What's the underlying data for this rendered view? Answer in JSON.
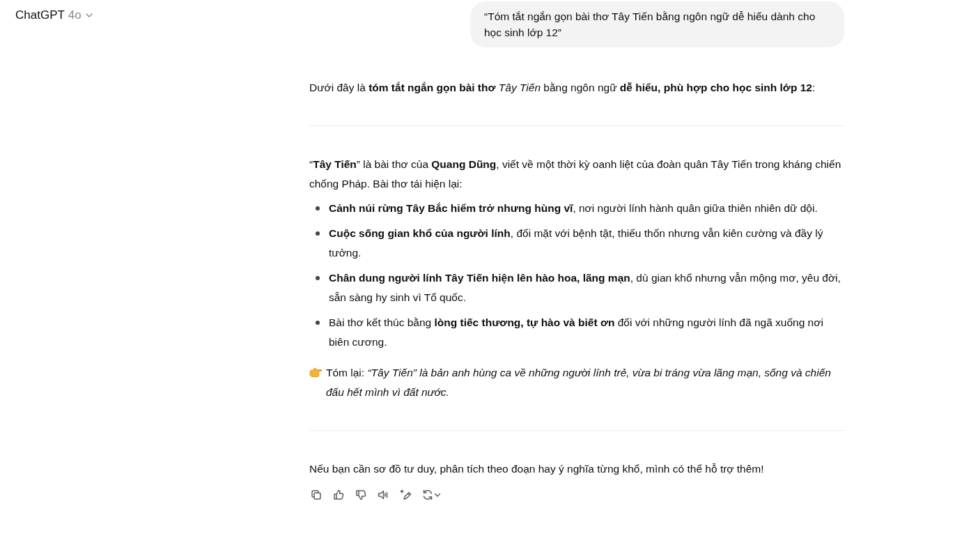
{
  "header": {
    "title": "ChatGPT",
    "model": "4o"
  },
  "user_message": "“Tóm tắt ngắn gọn bài thơ Tây Tiến bằng ngôn ngữ dễ hiểu dành cho học sinh lớp 12”",
  "assistant_message": {
    "blocks": [
      {
        "kind": "paragraph",
        "text": "Dưới đây là **tóm tắt ngắn gọn bài thơ** *Tây Tiến* bằng ngôn ngữ **dễ hiểu, phù hợp cho học sinh lớp 12**:"
      },
      {
        "kind": "divider"
      },
      {
        "kind": "paragraph",
        "text": "“**Tây Tiến**” là bài thơ của **Quang Dũng**, viết về một thời kỳ oanh liệt của đoàn quân Tây Tiến trong kháng chiến chống Pháp. Bài thơ tái hiện lại:"
      },
      {
        "kind": "list",
        "items": [
          "**Cảnh núi rừng Tây Bắc hiểm trở nhưng hùng vĩ**, nơi người lính hành quân giữa thiên nhiên dữ dội.",
          "**Cuộc sống gian khổ của người lính**, đối mặt với bệnh tật, thiếu thốn nhưng vẫn kiên cường và đầy lý tưởng.",
          "**Chân dung người lính Tây Tiến hiện lên hào hoa, lãng mạn**, dù gian khổ nhưng vẫn mộng mơ, yêu đời, sẵn sàng hy sinh vì Tổ quốc.",
          "Bài thơ kết thúc bằng **lòng tiếc thương, tự hào và biết ơn** đối với những người lính đã ngã xuống nơi biên cương."
        ]
      },
      {
        "kind": "summary",
        "text": "Tóm lại: *“Tây Tiến” là bản anh hùng ca về những người lính trẻ, vừa bi tráng vừa lãng mạn, sống và chiến đấu hết mình vì đất nước.*"
      },
      {
        "kind": "divider"
      },
      {
        "kind": "paragraph",
        "text": "Nếu bạn cần sơ đồ tư duy, phân tích theo đoạn hay ý nghĩa từng khổ, mình có thể hỗ trợ thêm!"
      }
    ]
  }
}
